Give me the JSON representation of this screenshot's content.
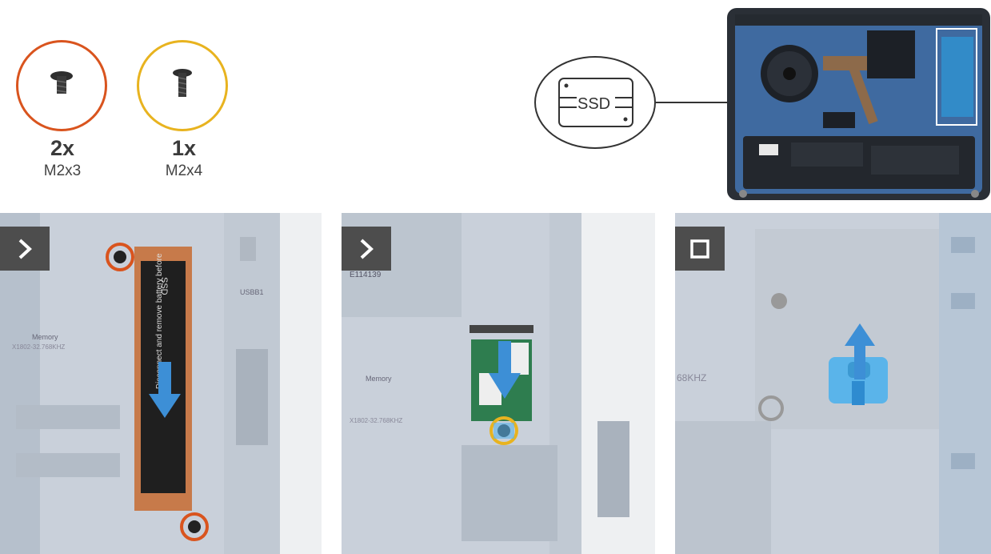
{
  "screws": [
    {
      "count": "2x",
      "size": "M2x3",
      "ring_color": "#d9541e"
    },
    {
      "count": "1x",
      "size": "M2x4",
      "ring_color": "#e8b31f"
    }
  ],
  "ssd_callout": {
    "label": "SSD"
  },
  "steps": [
    {
      "badge": "chevron-right"
    },
    {
      "badge": "chevron-right"
    },
    {
      "badge": "stop-square"
    }
  ],
  "colors": {
    "arrow_blue": "#3d8fd6",
    "board_blue": "#5d7da6",
    "badge_gray": "#4d4d4d",
    "copper": "#c77a4a",
    "tab_blue": "#5ab4ea"
  }
}
